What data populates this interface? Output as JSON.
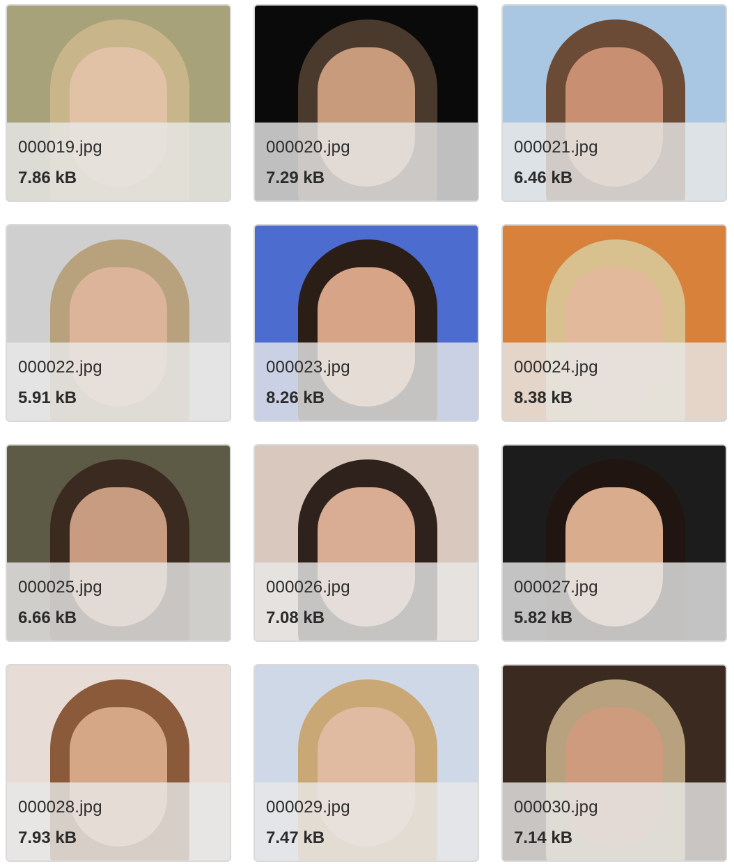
{
  "files": [
    {
      "name": "000019.jpg",
      "size": "7.86 kB",
      "bg": "#a8a27a",
      "hair": "#c9b58a",
      "skin": "#e2c2a6"
    },
    {
      "name": "000020.jpg",
      "size": "7.29 kB",
      "bg": "#0a0a0a",
      "hair": "#4a3a2e",
      "skin": "#c79b7b"
    },
    {
      "name": "000021.jpg",
      "size": "6.46 kB",
      "bg": "#a9c7e3",
      "hair": "#6b4a36",
      "skin": "#c98f72"
    },
    {
      "name": "000022.jpg",
      "size": "5.91 kB",
      "bg": "#cfcfcf",
      "hair": "#b8a27e",
      "skin": "#dcb49a"
    },
    {
      "name": "000023.jpg",
      "size": "8.26 kB",
      "bg": "#4c6ccf",
      "hair": "#2a1e17",
      "skin": "#d8a488"
    },
    {
      "name": "000024.jpg",
      "size": "8.38 kB",
      "bg": "#d7813a",
      "hair": "#d8c08f",
      "skin": "#e3b99c"
    },
    {
      "name": "000025.jpg",
      "size": "6.66 kB",
      "bg": "#5d5a45",
      "hair": "#3a2a20",
      "skin": "#c89c80"
    },
    {
      "name": "000026.jpg",
      "size": "7.08 kB",
      "bg": "#d8c8bd",
      "hair": "#2f221d",
      "skin": "#d8ad94"
    },
    {
      "name": "000027.jpg",
      "size": "5.82 kB",
      "bg": "#1c1c1c",
      "hair": "#201510",
      "skin": "#d9ac8d"
    },
    {
      "name": "000028.jpg",
      "size": "7.93 kB",
      "bg": "#e7dcd6",
      "hair": "#8a5a3a",
      "skin": "#d6a786"
    },
    {
      "name": "000029.jpg",
      "size": "7.47 kB",
      "bg": "#cfd8e6",
      "hair": "#c9a875",
      "skin": "#e0bba1"
    },
    {
      "name": "000030.jpg",
      "size": "7.14 kB",
      "bg": "#3b2a20",
      "hair": "#b7a17f",
      "skin": "#cf9b7e"
    }
  ]
}
